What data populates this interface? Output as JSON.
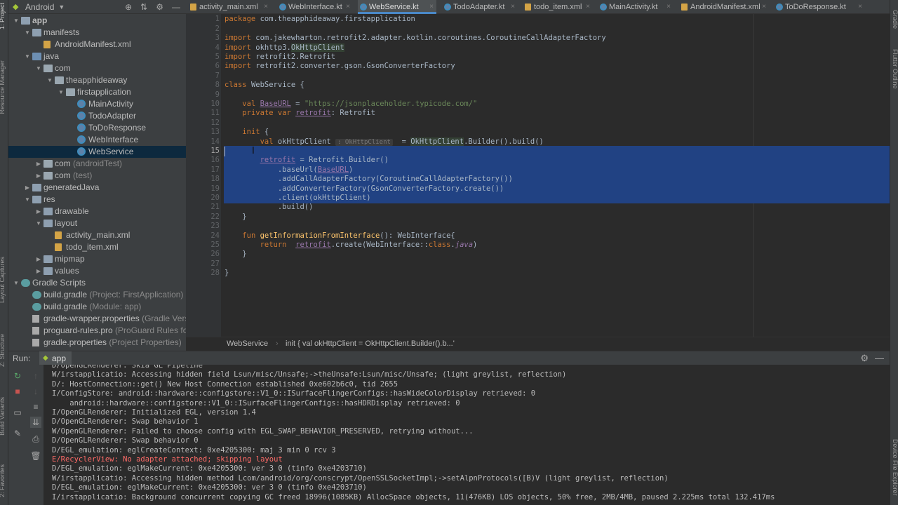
{
  "left_strip": {
    "tabs": [
      "1: Project",
      "Resource Manager",
      "Layout Captures",
      "Z: Structure",
      "Build Variants",
      "2: Favorites"
    ]
  },
  "right_strip": {
    "tabs": [
      "Gradle",
      "Flutter Outline",
      "Device File Explorer"
    ]
  },
  "project_panel": {
    "view_label": "Android",
    "tree": [
      {
        "label": "app",
        "suffix": "",
        "depth": 0,
        "arrow": "open",
        "icon": "folder",
        "bold": true
      },
      {
        "label": "manifests",
        "suffix": "",
        "depth": 1,
        "arrow": "open",
        "icon": "folder"
      },
      {
        "label": "AndroidManifest.xml",
        "suffix": "",
        "depth": 2,
        "arrow": "",
        "icon": "xml"
      },
      {
        "label": "java",
        "suffix": "",
        "depth": 1,
        "arrow": "open",
        "icon": "folder-blue"
      },
      {
        "label": "com",
        "suffix": "",
        "depth": 2,
        "arrow": "open",
        "icon": "pkg"
      },
      {
        "label": "theapphideaway",
        "suffix": "",
        "depth": 3,
        "arrow": "open",
        "icon": "pkg"
      },
      {
        "label": "firstapplication",
        "suffix": "",
        "depth": 4,
        "arrow": "open",
        "icon": "pkg"
      },
      {
        "label": "MainActivity",
        "suffix": "",
        "depth": 5,
        "arrow": "",
        "icon": "kt"
      },
      {
        "label": "TodoAdapter",
        "suffix": "",
        "depth": 5,
        "arrow": "",
        "icon": "kt"
      },
      {
        "label": "ToDoResponse",
        "suffix": "",
        "depth": 5,
        "arrow": "",
        "icon": "kt"
      },
      {
        "label": "WebInterface",
        "suffix": "",
        "depth": 5,
        "arrow": "",
        "icon": "kt"
      },
      {
        "label": "WebService",
        "suffix": "",
        "depth": 5,
        "arrow": "",
        "icon": "kt",
        "selected": true
      },
      {
        "label": "com",
        "suffix": " (androidTest)",
        "depth": 2,
        "arrow": "closed",
        "icon": "pkg"
      },
      {
        "label": "com",
        "suffix": " (test)",
        "depth": 2,
        "arrow": "closed",
        "icon": "pkg"
      },
      {
        "label": "generatedJava",
        "suffix": "",
        "depth": 1,
        "arrow": "closed",
        "icon": "folder"
      },
      {
        "label": "res",
        "suffix": "",
        "depth": 1,
        "arrow": "open",
        "icon": "folder"
      },
      {
        "label": "drawable",
        "suffix": "",
        "depth": 2,
        "arrow": "closed",
        "icon": "folder"
      },
      {
        "label": "layout",
        "suffix": "",
        "depth": 2,
        "arrow": "open",
        "icon": "folder"
      },
      {
        "label": "activity_main.xml",
        "suffix": "",
        "depth": 3,
        "arrow": "",
        "icon": "xml"
      },
      {
        "label": "todo_item.xml",
        "suffix": "",
        "depth": 3,
        "arrow": "",
        "icon": "xml"
      },
      {
        "label": "mipmap",
        "suffix": "",
        "depth": 2,
        "arrow": "closed",
        "icon": "folder"
      },
      {
        "label": "values",
        "suffix": "",
        "depth": 2,
        "arrow": "closed",
        "icon": "folder"
      },
      {
        "label": "Gradle Scripts",
        "suffix": "",
        "depth": 0,
        "arrow": "open",
        "icon": "gradle"
      },
      {
        "label": "build.gradle",
        "suffix": " (Project: FirstApplication)",
        "depth": 1,
        "arrow": "",
        "icon": "gradle"
      },
      {
        "label": "build.gradle",
        "suffix": " (Module: app)",
        "depth": 1,
        "arrow": "",
        "icon": "gradle"
      },
      {
        "label": "gradle-wrapper.properties",
        "suffix": " (Gradle Version)",
        "depth": 1,
        "arrow": "",
        "icon": "file"
      },
      {
        "label": "proguard-rules.pro",
        "suffix": " (ProGuard Rules for app)",
        "depth": 1,
        "arrow": "",
        "icon": "file"
      },
      {
        "label": "gradle.properties",
        "suffix": " (Project Properties)",
        "depth": 1,
        "arrow": "",
        "icon": "file"
      }
    ]
  },
  "editor_tabs": [
    {
      "label": "activity_main.xml",
      "type": "xml",
      "active": false
    },
    {
      "label": "WebInterface.kt",
      "type": "kt",
      "active": false
    },
    {
      "label": "WebService.kt",
      "type": "kt",
      "active": true
    },
    {
      "label": "TodoAdapter.kt",
      "type": "kt",
      "active": false
    },
    {
      "label": "todo_item.xml",
      "type": "xml",
      "active": false
    },
    {
      "label": "MainActivity.kt",
      "type": "kt",
      "active": false
    },
    {
      "label": "AndroidManifest.xml",
      "type": "xml",
      "active": false
    },
    {
      "label": "ToDoResponse.kt",
      "type": "kt",
      "active": false
    }
  ],
  "code": {
    "line_numbers": [
      "1",
      "2",
      "3",
      "4",
      "5",
      "6",
      "7",
      "8",
      "9",
      "10",
      "11",
      "12",
      "13",
      "14",
      "15",
      "16",
      "17",
      "18",
      "19",
      "20",
      "21",
      "22",
      "23",
      "24",
      "25",
      "26",
      "27",
      "28"
    ],
    "current_line": "15",
    "inline_hint": ": OkHttpClient"
  },
  "breadcrumb": {
    "items": [
      "WebService",
      "init { val okHttpClient = OkHttpClient.Builder().b...'"
    ]
  },
  "run_panel": {
    "label": "Run:",
    "config_name": "app",
    "lines": [
      {
        "text": "D/OpenGLRenderer: Skia GL Pipeline",
        "level": "normal"
      },
      {
        "text": "W/irstapplicatio: Accessing hidden field Lsun/misc/Unsafe;->theUnsafe:Lsun/misc/Unsafe; (light greylist, reflection)",
        "level": "normal"
      },
      {
        "text": "D/: HostConnection::get() New Host Connection established 0xe602b6c0, tid 2655",
        "level": "normal"
      },
      {
        "text": "I/ConfigStore: android::hardware::configstore::V1_0::ISurfaceFlingerConfigs::hasWideColorDisplay retrieved: 0",
        "level": "normal"
      },
      {
        "text": "    android::hardware::configstore::V1_0::ISurfaceFlingerConfigs::hasHDRDisplay retrieved: 0",
        "level": "normal"
      },
      {
        "text": "I/OpenGLRenderer: Initialized EGL, version 1.4",
        "level": "normal"
      },
      {
        "text": "D/OpenGLRenderer: Swap behavior 1",
        "level": "normal"
      },
      {
        "text": "W/OpenGLRenderer: Failed to choose config with EGL_SWAP_BEHAVIOR_PRESERVED, retrying without...",
        "level": "normal"
      },
      {
        "text": "D/OpenGLRenderer: Swap behavior 0",
        "level": "normal"
      },
      {
        "text": "D/EGL_emulation: eglCreateContext: 0xe4205300: maj 3 min 0 rcv 3",
        "level": "normal"
      },
      {
        "text": "E/RecyclerView: No adapter attached; skipping layout",
        "level": "error"
      },
      {
        "text": "D/EGL_emulation: eglMakeCurrent: 0xe4205300: ver 3 0 (tinfo 0xe4203710)",
        "level": "normal"
      },
      {
        "text": "W/irstapplicatio: Accessing hidden method Lcom/android/org/conscrypt/OpenSSLSocketImpl;->setAlpnProtocols([B)V (light greylist, reflection)",
        "level": "normal"
      },
      {
        "text": "D/EGL_emulation: eglMakeCurrent: 0xe4205300: ver 3 0 (tinfo 0xe4203710)",
        "level": "normal"
      },
      {
        "text": "I/irstapplicatio: Background concurrent copying GC freed 18996(1085KB) AllocSpace objects, 11(476KB) LOS objects, 50% free, 2MB/4MB, paused 2.225ms total 132.417ms",
        "level": "normal"
      }
    ]
  },
  "colors": {
    "accent": "#4a88c7",
    "selection": "#214283",
    "keyword": "#cc7832",
    "string": "#6a8759",
    "property": "#9876aa",
    "function": "#ffc66d",
    "error": "#ff6b68"
  }
}
